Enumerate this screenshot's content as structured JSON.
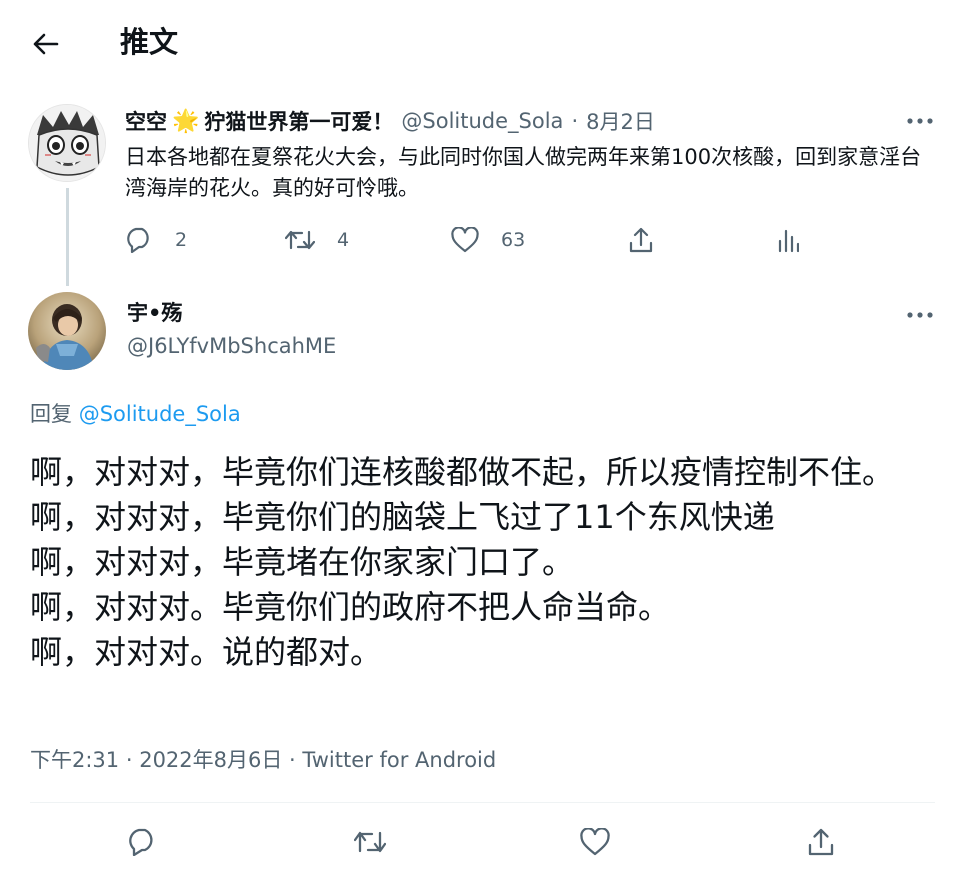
{
  "header": {
    "title": "推文",
    "back_icon": "arrow-left-icon"
  },
  "parent_tweet": {
    "display_name": "空空",
    "emoji": "🌟",
    "display_name_suffix": "狞猫世界第一可爱！",
    "handle": "@Solitude_Sola",
    "separator": "·",
    "date": "8月2日",
    "text": "日本各地都在夏祭花火大会，与此同时你国人做完两年来第100次核酸，回到家意淫台湾海岸的花火。真的好可怜哦。",
    "replies": "2",
    "retweets": "4",
    "likes": "63",
    "more_icon": "more-icon"
  },
  "main_tweet": {
    "display_name": "宇•殇",
    "handle": "@J6LYfvMbShcahME",
    "reply_prefix": "回复 ",
    "reply_handle": "@Solitude_Sola",
    "lines": [
      "啊，对对对，毕竟你们连核酸都做不起，所以疫情控制不住。",
      "啊，对对对，毕竟你们的脑袋上飞过了11个东风快递",
      "啊，对对对，毕竟堵在你家家门口了。",
      "啊，对对对。毕竟你们的政府不把人命当命。",
      "啊，对对对。说的都对。"
    ],
    "time": "下午2:31",
    "dot1": " · ",
    "date": "2022年8月6日",
    "dot2": " · ",
    "source": "Twitter for Android"
  },
  "colors": {
    "link": "#1d9bf0",
    "secondary": "#536471",
    "text": "#0f1419",
    "star": "#f5a623"
  }
}
